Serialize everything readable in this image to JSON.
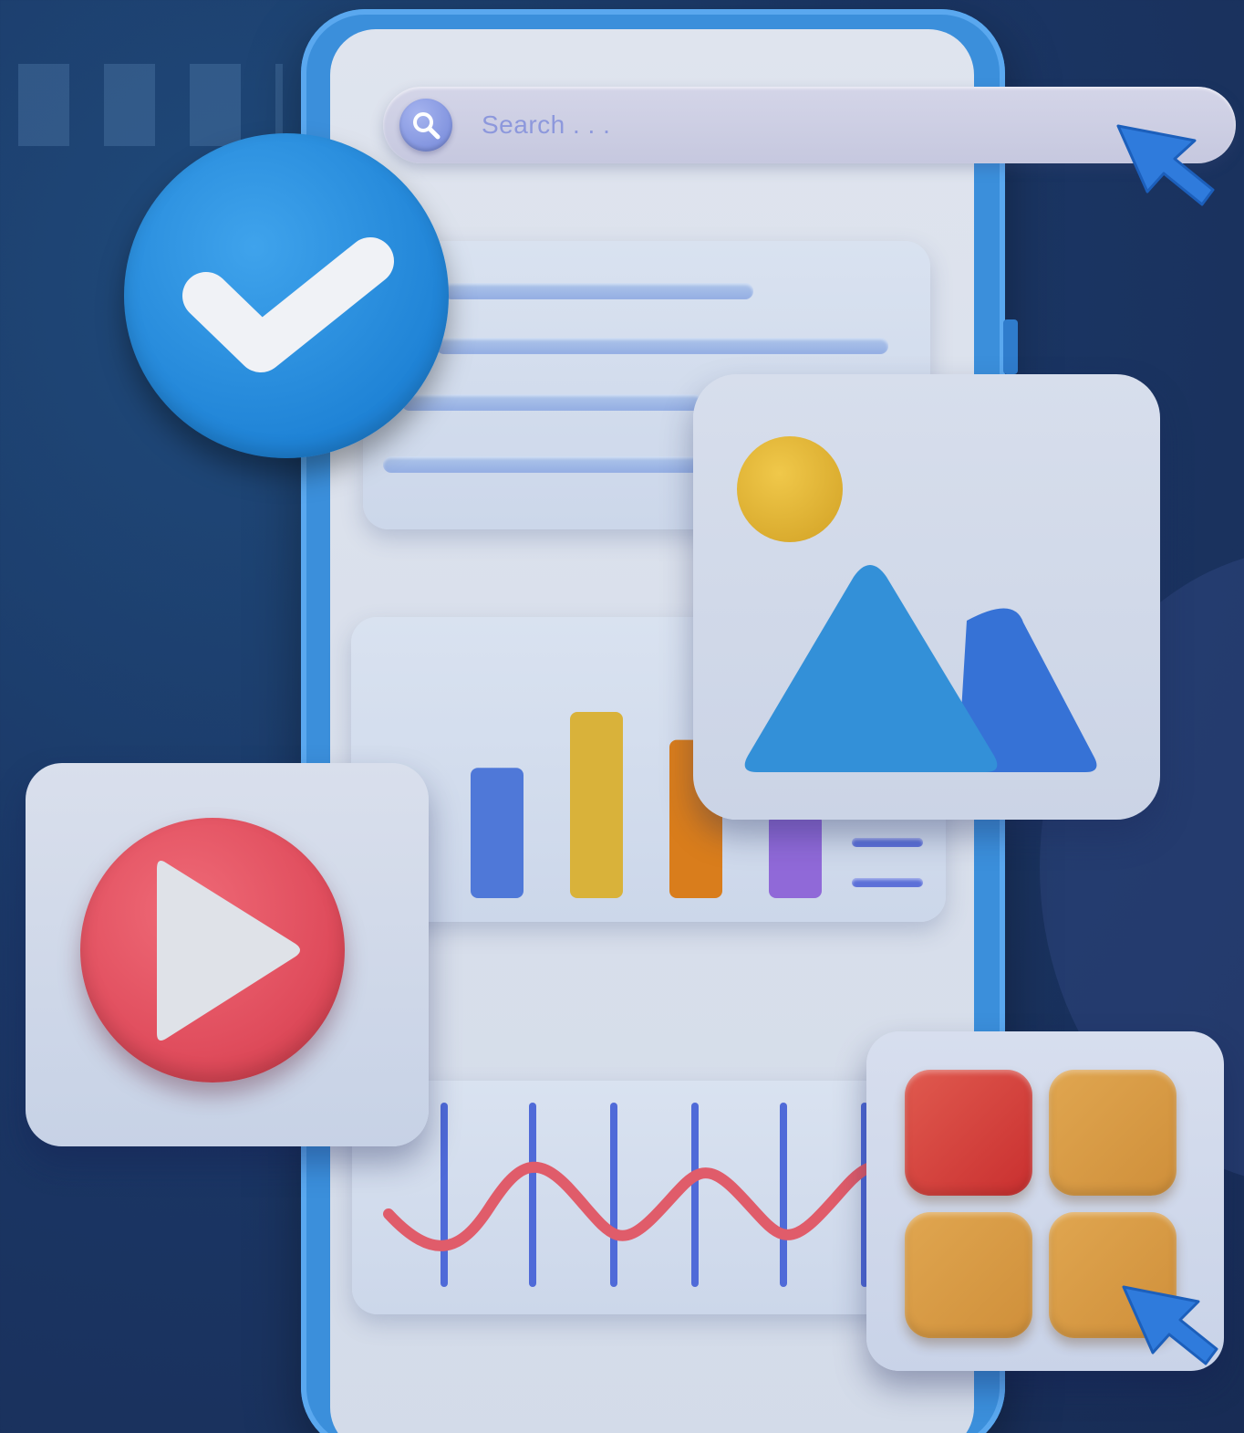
{
  "search": {
    "placeholder": "Search . . ."
  },
  "icons": {
    "search": "search-icon",
    "check": "check-icon",
    "play": "play-icon",
    "image": "image-icon",
    "cursor": "cursor-icon"
  },
  "colors": {
    "background": "#1b3766",
    "phone_frame": "#3b8fdb",
    "check_badge": "#1f83d6",
    "play_button": "#e04d5d",
    "sun": "#e0b93a",
    "mountain_large": "#3390d8",
    "mountain_small": "#3672d6",
    "wave": "#e05c6a",
    "tile_red": "#d94140",
    "tile_orange": "#d79a45"
  },
  "chart_data": {
    "type": "bar",
    "categories": [
      "",
      "",
      "",
      ""
    ],
    "values": [
      70,
      100,
      85,
      45
    ],
    "colors": [
      "#4f78d8",
      "#d9b23a",
      "#d97d1c",
      "#9069d8"
    ],
    "ylim": [
      0,
      100
    ],
    "title": "",
    "xlabel": "",
    "ylabel": ""
  }
}
